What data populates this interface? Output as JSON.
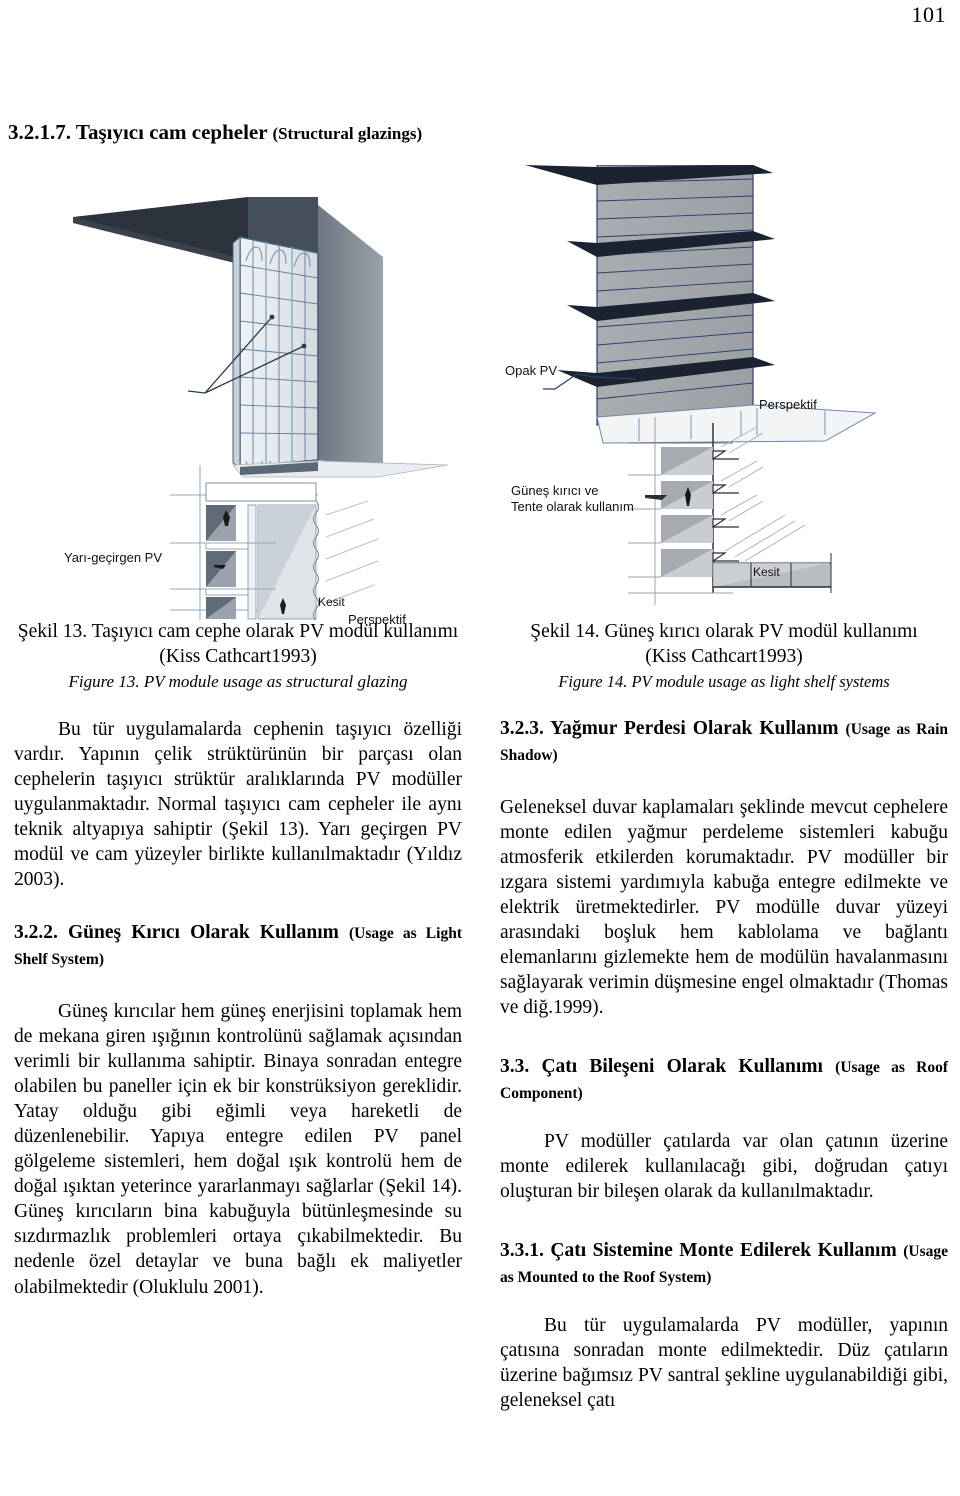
{
  "page": {
    "number": "101"
  },
  "top_heading": {
    "number_title": "3.2.1.7. Taşıyıcı cam cepheler",
    "english": "(Structural glazings)"
  },
  "figures": {
    "left": {
      "label_pv": "Yarı-geçirgen PV",
      "label_perspective": "Perspektif",
      "label_section": "Kesit",
      "caption_tr": "Şekil 13. Taşıyıcı cam cephe olarak PV modül kullanımı (Kiss Cathcart1993)",
      "caption_en": "Figure 13. PV module usage as structural glazing"
    },
    "right": {
      "label_pv": "Opak PV",
      "label_perspective": "Perspektif",
      "label_usage": "Güneş kırıcı ve\nTente olarak kullanım",
      "label_section": "Kesit",
      "caption_tr_line1": "Şekil 14. Güneş kırıcı olarak PV modül kullanımı",
      "caption_tr_line2": "(Kiss Cathcart1993)",
      "caption_en": "Figure 14. PV module usage as light shelf systems"
    }
  },
  "left_column": {
    "paragraph_1": "Bu tür uygulamalarda cephenin taşıyıcı özelliği vardır. Yapının çelik strüktürünün bir parçası olan cephelerin taşıyıcı strüktür aralıklarında PV modüller uygulanmaktadır. Normal taşıyıcı cam cepheler ile aynı teknik altyapıya sahiptir (Şekil 13). Yarı geçirgen PV modül ve cam yüzeyler birlikte kullanılmaktadır (Yıldız 2003).",
    "heading_2_tr": "3.2.2. Güneş Kırıcı Olarak Kullanım",
    "heading_2_en": "(Usage as Light Shelf System)",
    "paragraph_2": "Güneş kırıcılar hem güneş enerjisini toplamak hem de mekana giren ışığının kontrolünü sağlamak açısından verimli bir kullanıma sahiptir. Binaya sonradan entegre olabilen bu paneller için ek bir konstrüksiyon gereklidir. Yatay olduğu gibi eğimli veya hareketli de düzenlenebilir. Yapıya entegre edilen PV panel gölgeleme sistemleri, hem doğal ışık kontrolü hem de doğal ışıktan yeterince yararlanmayı sağlarlar (Şekil 14). Güneş kırıcıların bina kabuğuyla bütünleşmesinde su sızdırmazlık problemleri ortaya çıkabilmektedir. Bu nedenle özel detaylar ve buna bağlı ek maliyetler olabilmektedir (Oluklulu 2001)."
  },
  "right_column": {
    "heading_3_tr": "3.2.3. Yağmur Perdesi Olarak Kullanım",
    "heading_3_en": "(Usage as Rain Shadow)",
    "paragraph_1": "Geleneksel duvar kaplamaları şeklinde mevcut cephelere monte edilen yağmur perdeleme sistemleri kabuğu atmosferik etkilerden korumaktadır. PV modüller bir ızgara sistemi yardımıyla kabuğa entegre edilmekte ve elektrik üretmektedirler. PV modülle duvar yüzeyi arasındaki boşluk hem kablolama ve bağlantı elemanlarını gizlemekte hem de modülün havalanmasını sağlayarak verimin düşmesine engel olmaktadır (Thomas ve diğ.1999).",
    "heading_4_tr": "3.3. Çatı Bileşeni Olarak Kullanımı",
    "heading_4_en": "(Usage as Roof Component)",
    "paragraph_2": "PV modüller çatılarda var olan çatının üzerine monte edilerek kullanılacağı gibi, doğrudan çatıyı oluşturan bir bileşen olarak da kullanılmaktadır.",
    "heading_5_tr": "3.3.1. Çatı Sistemine Monte Edilerek Kullanım",
    "heading_5_en": "(Usage as Mounted to the Roof System)",
    "paragraph_3": "Bu tür uygulamalarda PV modüller, yapının çatısına sonradan monte edilmektedir. Düz çatıların üzerine bağımsız PV santral şekline uygulanabildiği gibi, geleneksel çatı"
  },
  "colors": {
    "panel_light": "#e4e8ec",
    "panel_mid": "#b9bec4",
    "frame_dark": "#3b4654",
    "roof_dark": "#2d3541",
    "line_blue": "#35526e",
    "ink": "#000000"
  }
}
